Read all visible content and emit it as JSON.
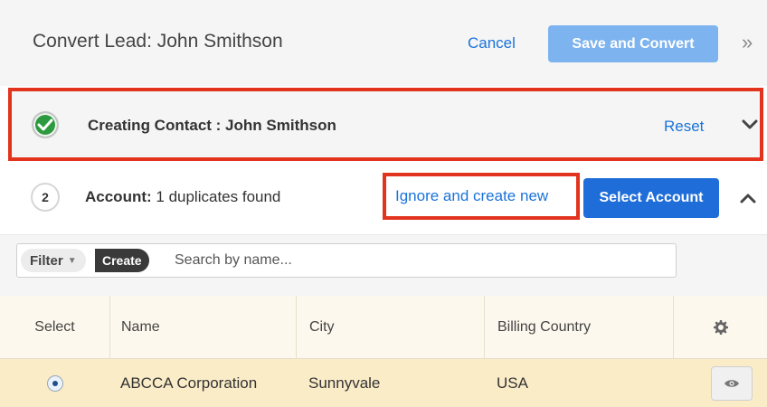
{
  "header": {
    "title": "Convert Lead: John Smithson",
    "cancel_label": "Cancel",
    "save_label": "Save and Convert",
    "expand_glyph": "»"
  },
  "contact": {
    "label": "Creating Contact : John Smithson",
    "reset_label": "Reset",
    "status_icon": "check-circle-icon",
    "status_color": "#2e9a3f"
  },
  "account": {
    "step_number": "2",
    "label_bold": "Account:",
    "label_rest": " 1 duplicates found",
    "ignore_label": "Ignore and create new",
    "select_label": "Select Account"
  },
  "filter": {
    "filter_label": "Filter",
    "create_label": "Create",
    "search_placeholder": "Search by name..."
  },
  "table": {
    "columns": [
      "Select",
      "Name",
      "City",
      "Billing Country"
    ],
    "rows": [
      {
        "name": "ABCCA Corporation",
        "city": "Sunnyvale",
        "country": "USA",
        "selected": true
      }
    ]
  },
  "colors": {
    "accent_blue": "#1f6dd8",
    "link_blue": "#1a73d9",
    "highlight_red": "#e2341d",
    "row_highlight": "#fbecc8"
  }
}
